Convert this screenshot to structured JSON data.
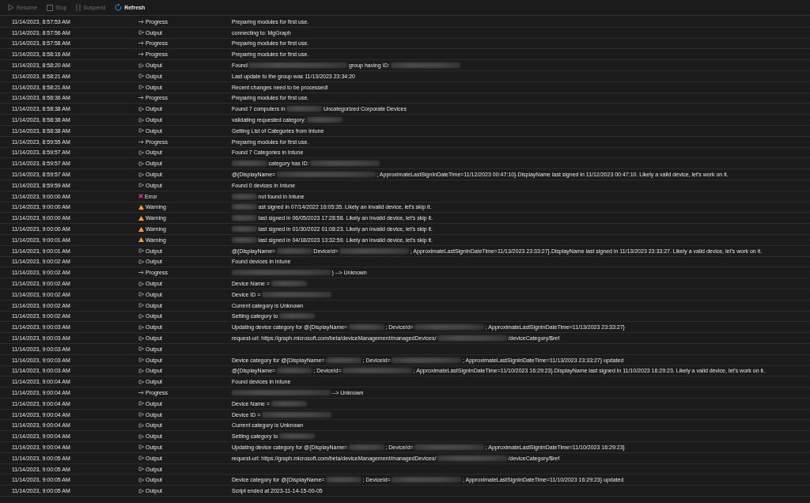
{
  "toolbar": [
    {
      "kind": "resume",
      "label": "Resume",
      "disabled": true
    },
    {
      "kind": "stop",
      "label": "Stop",
      "disabled": true
    },
    {
      "kind": "suspend",
      "label": "Suspend",
      "disabled": true
    },
    {
      "kind": "refresh",
      "label": "Refresh",
      "disabled": false
    }
  ],
  "rows": [
    {
      "time": "11/14/2023, 8:57:53 AM",
      "kind": "progress",
      "type": "Progress",
      "message": [
        {
          "kind": "text",
          "text": "Preparing modules for first use."
        }
      ]
    },
    {
      "time": "11/14/2023, 8:57:56 AM",
      "kind": "output",
      "type": "Output",
      "message": [
        {
          "kind": "text",
          "text": "connecting to: MgGraph"
        }
      ]
    },
    {
      "time": "11/14/2023, 8:57:58 AM",
      "kind": "progress",
      "type": "Progress",
      "message": [
        {
          "kind": "text",
          "text": "Preparing modules for first use."
        }
      ]
    },
    {
      "time": "11/14/2023, 8:58:16 AM",
      "kind": "progress",
      "type": "Progress",
      "message": [
        {
          "kind": "text",
          "text": "Preparing modules for first use."
        }
      ]
    },
    {
      "time": "11/14/2023, 8:58:20 AM",
      "kind": "output",
      "type": "Output",
      "message": [
        {
          "kind": "text",
          "text": "Found"
        },
        {
          "kind": "wide"
        },
        {
          "kind": "text",
          "text": "group having ID:"
        },
        {
          "kind": "long"
        }
      ]
    },
    {
      "time": "11/14/2023, 8:58:21 AM",
      "kind": "output",
      "type": "Output",
      "message": [
        {
          "kind": "text",
          "text": "Last update to the group was 11/13/2023 23:34:20"
        }
      ]
    },
    {
      "time": "11/14/2023, 8:58:21 AM",
      "kind": "output",
      "type": "Output",
      "message": [
        {
          "kind": "text",
          "text": "Recent changes need to be processed!"
        }
      ]
    },
    {
      "time": "11/14/2023, 8:58:36 AM",
      "kind": "progress",
      "type": "Progress",
      "message": [
        {
          "kind": "text",
          "text": "Preparing modules for first use."
        }
      ]
    },
    {
      "time": "11/14/2023, 8:58:38 AM",
      "kind": "output",
      "type": "Output",
      "message": [
        {
          "kind": "text",
          "text": "Found 7 computers in"
        },
        {
          "kind": "medium"
        },
        {
          "kind": "text",
          "text": "Uncategorized Corporate Devices"
        }
      ]
    },
    {
      "time": "11/14/2023, 8:58:38 AM",
      "kind": "output",
      "type": "Output",
      "message": [
        {
          "kind": "text",
          "text": "validating requested category:"
        },
        {
          "kind": "medium"
        }
      ]
    },
    {
      "time": "11/14/2023, 8:58:38 AM",
      "kind": "output",
      "type": "Output",
      "message": [
        {
          "kind": "text",
          "text": "Getting List of Categories from Intune"
        }
      ]
    },
    {
      "time": "11/14/2023, 8:59:55 AM",
      "kind": "progress",
      "type": "Progress",
      "message": [
        {
          "kind": "text",
          "text": "Preparing modules for first use."
        }
      ]
    },
    {
      "time": "11/14/2023, 8:59:57 AM",
      "kind": "output",
      "type": "Output",
      "message": [
        {
          "kind": "text",
          "text": "Found 7 Categories in Intune"
        }
      ]
    },
    {
      "time": "11/14/2023, 8:59:57 AM",
      "kind": "output",
      "type": "Output",
      "message": [
        {
          "kind": "medium"
        },
        {
          "kind": "text",
          "text": "category has ID:"
        },
        {
          "kind": "long"
        }
      ]
    },
    {
      "time": "11/14/2023, 8:59:57 AM",
      "kind": "output",
      "type": "Output",
      "message": [
        {
          "kind": "text",
          "text": "@{DisplayName="
        },
        {
          "kind": "wide"
        },
        {
          "kind": "text",
          "text": "; ApproximateLastSignInDateTime=11/12/2023 00:47:10}.DisplayName last signed in 11/12/2023 00:47:10. Likely a valid device, let's work on it."
        }
      ]
    },
    {
      "time": "11/14/2023, 8:59:59 AM",
      "kind": "output",
      "type": "Output",
      "message": [
        {
          "kind": "text",
          "text": "Found 0 devices in Intune"
        }
      ]
    },
    {
      "time": "11/14/2023, 9:00:00 AM",
      "kind": "error",
      "type": "Error",
      "message": [
        {
          "kind": "short"
        },
        {
          "kind": "text",
          "text": "not found in Intune"
        }
      ]
    },
    {
      "time": "11/14/2023, 9:00:00 AM",
      "kind": "warning",
      "type": "Warning",
      "message": [
        {
          "kind": "short"
        },
        {
          "kind": "text",
          "text": "ast signed in 07/14/2022 16:05:35. Likely an invalid device, let's skip it."
        }
      ]
    },
    {
      "time": "11/14/2023, 9:00:00 AM",
      "kind": "warning",
      "type": "Warning",
      "message": [
        {
          "kind": "short"
        },
        {
          "kind": "text",
          "text": "last signed in 06/05/2023 17:28:58. Likely an invalid device, let's skip it."
        }
      ]
    },
    {
      "time": "11/14/2023, 9:00:00 AM",
      "kind": "warning",
      "type": "Warning",
      "message": [
        {
          "kind": "short"
        },
        {
          "kind": "text",
          "text": "last signed in 01/30/2022 01:08:23. Likely an invalid device, let's skip it."
        }
      ]
    },
    {
      "time": "11/14/2023, 9:00:01 AM",
      "kind": "warning",
      "type": "Warning",
      "message": [
        {
          "kind": "short"
        },
        {
          "kind": "text",
          "text": "last signed in 04/18/2023 13:32:59. Likely an invalid device, let's skip it."
        }
      ]
    },
    {
      "time": "11/14/2023, 9:00:01 AM",
      "kind": "output",
      "type": "Output",
      "message": [
        {
          "kind": "text",
          "text": "@{DisplayName="
        },
        {
          "kind": "medium"
        },
        {
          "kind": "text",
          "text": "DeviceId="
        },
        {
          "kind": "long"
        },
        {
          "kind": "text",
          "text": "; ApproximateLastSignInDateTime=11/13/2023 23:33:27}.DisplayName last signed in 11/13/2023 23:33:27. Likely a valid device, let's work on it."
        }
      ]
    },
    {
      "time": "11/14/2023, 9:00:02 AM",
      "kind": "output",
      "type": "Output",
      "message": [
        {
          "kind": "text",
          "text": "Found devices in Intune"
        }
      ]
    },
    {
      "time": "11/14/2023, 9:00:02 AM",
      "kind": "progress",
      "type": "Progress",
      "message": [
        {
          "kind": "wide"
        },
        {
          "kind": "text",
          "text": ") --> Unknown"
        }
      ]
    },
    {
      "time": "11/14/2023, 9:00:02 AM",
      "kind": "output",
      "type": "Output",
      "message": [
        {
          "kind": "text",
          "text": "Device Name ="
        },
        {
          "kind": "medium"
        }
      ]
    },
    {
      "time": "11/14/2023, 9:00:02 AM",
      "kind": "output",
      "type": "Output",
      "message": [
        {
          "kind": "text",
          "text": "Device ID ="
        },
        {
          "kind": "long"
        }
      ]
    },
    {
      "time": "11/14/2023, 9:00:02 AM",
      "kind": "output",
      "type": "Output",
      "message": [
        {
          "kind": "text",
          "text": "Current category is Unknown"
        }
      ]
    },
    {
      "time": "11/14/2023, 9:00:02 AM",
      "kind": "output",
      "type": "Output",
      "message": [
        {
          "kind": "text",
          "text": "Setting category to"
        },
        {
          "kind": "medium"
        }
      ]
    },
    {
      "time": "11/14/2023, 9:00:03 AM",
      "kind": "output",
      "type": "Output",
      "message": [
        {
          "kind": "text",
          "text": "Updating device category for @{DisplayName="
        },
        {
          "kind": "medium"
        },
        {
          "kind": "text",
          "text": "; DeviceId="
        },
        {
          "kind": "long"
        },
        {
          "kind": "text",
          "text": "; ApproximateLastSignInDateTime=11/13/2023 23:33:27}"
        }
      ]
    },
    {
      "time": "11/14/2023, 9:00:03 AM",
      "kind": "output",
      "type": "Output",
      "message": [
        {
          "kind": "text",
          "text": "request-url: https://graph.microsoft.com/beta/deviceManagement/managedDevices/"
        },
        {
          "kind": "long"
        },
        {
          "kind": "text",
          "text": "/deviceCategory/$ref"
        }
      ]
    },
    {
      "time": "11/14/2023, 9:00:03 AM",
      "kind": "output",
      "type": "Output"
    },
    {
      "time": "11/14/2023, 9:00:03 AM",
      "kind": "output",
      "type": "Output",
      "message": [
        {
          "kind": "text",
          "text": "Device category for @{DisplayName="
        },
        {
          "kind": "medium"
        },
        {
          "kind": "text",
          "text": "; DeviceId="
        },
        {
          "kind": "long"
        },
        {
          "kind": "text",
          "text": "; ApproximateLastSignInDateTime=11/13/2023 23:33:27} updated"
        }
      ]
    },
    {
      "time": "11/14/2023, 9:00:03 AM",
      "kind": "output",
      "type": "Output",
      "message": [
        {
          "kind": "text",
          "text": "@{DisplayName="
        },
        {
          "kind": "medium"
        },
        {
          "kind": "text",
          "text": "; DeviceId="
        },
        {
          "kind": "long"
        },
        {
          "kind": "text",
          "text": "; ApproximateLastSignInDateTime=11/10/2023 16:29:23}.DisplayName last signed in 11/10/2023 16:29:23. Likely a valid device, let's work on it."
        }
      ]
    },
    {
      "time": "11/14/2023, 9:00:04 AM",
      "kind": "output",
      "type": "Output",
      "message": [
        {
          "kind": "text",
          "text": "Found devices in Intune"
        }
      ]
    },
    {
      "time": "11/14/2023, 9:00:04 AM",
      "kind": "progress",
      "type": "Progress",
      "message": [
        {
          "kind": "wide"
        },
        {
          "kind": "text",
          "text": "--> Unknown"
        }
      ]
    },
    {
      "time": "11/14/2023, 9:00:04 AM",
      "kind": "output",
      "type": "Output",
      "message": [
        {
          "kind": "text",
          "text": "Device Name ="
        },
        {
          "kind": "medium"
        }
      ]
    },
    {
      "time": "11/14/2023, 9:00:04 AM",
      "kind": "output",
      "type": "Output",
      "message": [
        {
          "kind": "text",
          "text": "Device ID ="
        },
        {
          "kind": "long"
        }
      ]
    },
    {
      "time": "11/14/2023, 9:00:04 AM",
      "kind": "output",
      "type": "Output",
      "message": [
        {
          "kind": "text",
          "text": "Current category is Unknown"
        }
      ]
    },
    {
      "time": "11/14/2023, 9:00:04 AM",
      "kind": "output",
      "type": "Output",
      "message": [
        {
          "kind": "text",
          "text": "Setting category to"
        },
        {
          "kind": "medium"
        }
      ]
    },
    {
      "time": "11/14/2023, 9:00:04 AM",
      "kind": "output",
      "type": "Output",
      "message": [
        {
          "kind": "text",
          "text": "Updating device category for @{DisplayName="
        },
        {
          "kind": "medium"
        },
        {
          "kind": "text",
          "text": "; DeviceId="
        },
        {
          "kind": "long"
        },
        {
          "kind": "text",
          "text": "; ApproximateLastSignInDateTime=11/10/2023 16:29:23}"
        }
      ]
    },
    {
      "time": "11/14/2023, 9:00:05 AM",
      "kind": "output",
      "type": "Output",
      "message": [
        {
          "kind": "text",
          "text": "request-url: https://graph.microsoft.com/beta/deviceManagement/managedDevices/"
        },
        {
          "kind": "long"
        },
        {
          "kind": "text",
          "text": "/deviceCategory/$ref"
        }
      ]
    },
    {
      "time": "11/14/2023, 9:00:05 AM",
      "kind": "output",
      "type": "Output"
    },
    {
      "time": "11/14/2023, 9:00:05 AM",
      "kind": "output",
      "type": "Output",
      "message": [
        {
          "kind": "text",
          "text": "Device category for @{DisplayName="
        },
        {
          "kind": "medium"
        },
        {
          "kind": "text",
          "text": "; DeviceId="
        },
        {
          "kind": "long"
        },
        {
          "kind": "text",
          "text": "; ApproximateLastSignInDateTime=11/10/2023 16:29:23} updated"
        }
      ]
    },
    {
      "time": "11/14/2023, 9:00:05 AM",
      "kind": "output",
      "type": "Output",
      "message": [
        {
          "kind": "text",
          "text": "Script ended at 2023-11-14-15-00-05"
        }
      ]
    }
  ]
}
